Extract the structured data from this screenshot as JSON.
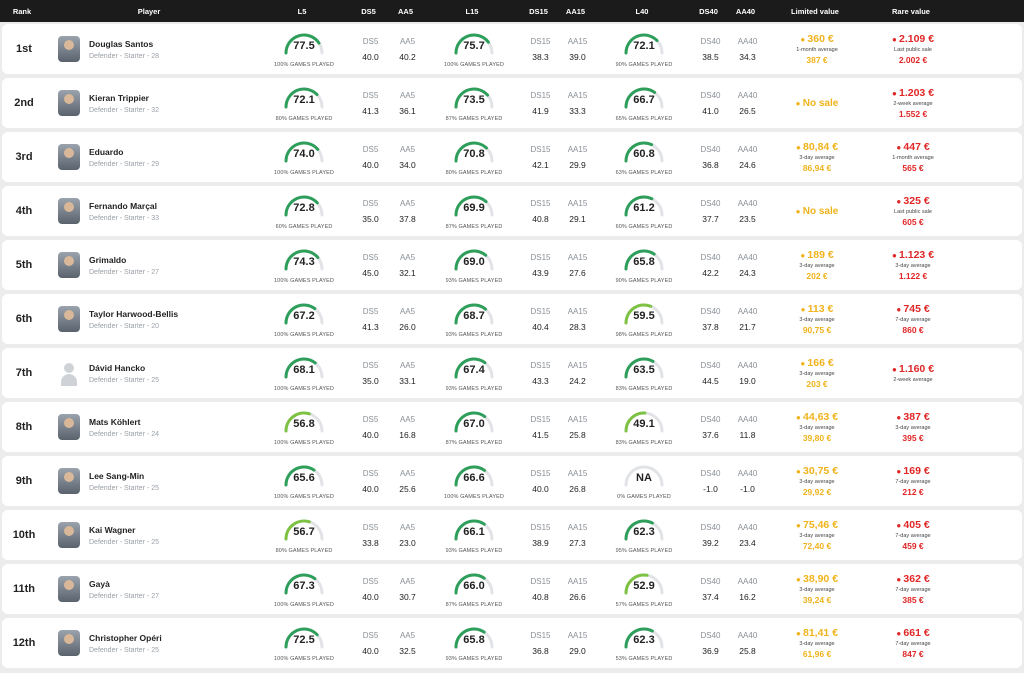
{
  "header": {
    "rank": "Rank",
    "player": "Player",
    "l5": "L5",
    "ds5": "DS5",
    "aa5": "AA5",
    "l15": "L15",
    "ds15": "DS15",
    "aa15": "AA15",
    "l40": "L40",
    "ds40": "DS40",
    "aa40": "AA40",
    "limited": "Limited value",
    "rare": "Rare value"
  },
  "labels": {
    "ds5": "DS5",
    "aa5": "AA5",
    "ds15": "DS15",
    "aa15": "AA15",
    "ds40": "DS40",
    "aa40": "AA40"
  },
  "colors": {
    "limited": "#f0b31c",
    "rare": "#e02626",
    "gauge_green": "#2e9e5b",
    "gauge_light": "#7dc242",
    "track": "#e1e3e6"
  },
  "rows": [
    {
      "rank": "1st",
      "name": "Douglas Santos",
      "desc": "Defender - Starter - 28",
      "l5": {
        "v": "77.5",
        "p": "100% GAMES PLAYED",
        "f": 0.775
      },
      "ds5": "40.0",
      "aa5": "40.2",
      "l15": {
        "v": "75.7",
        "p": "100% GAMES PLAYED",
        "f": 0.757
      },
      "ds15": "38.3",
      "aa15": "39.0",
      "l40": {
        "v": "72.1",
        "p": "90% GAMES PLAYED",
        "f": 0.721
      },
      "ds40": "38.5",
      "aa40": "34.3",
      "lim": {
        "main": "360 €",
        "label": "1-month average",
        "sub": "387 €"
      },
      "rare": {
        "main": "2.109 €",
        "label": "Last public sale",
        "sub": "2.002 €"
      }
    },
    {
      "rank": "2nd",
      "name": "Kieran Trippier",
      "desc": "Defender - Starter - 32",
      "l5": {
        "v": "72.1",
        "p": "80% GAMES PLAYED",
        "f": 0.721
      },
      "ds5": "41.3",
      "aa5": "36.1",
      "l15": {
        "v": "73.5",
        "p": "87% GAMES PLAYED",
        "f": 0.735
      },
      "ds15": "41.9",
      "aa15": "33.3",
      "l40": {
        "v": "66.7",
        "p": "65% GAMES PLAYED",
        "f": 0.667
      },
      "ds40": "41.0",
      "aa40": "26.5",
      "lim": {
        "main": "No sale",
        "label": "",
        "sub": ""
      },
      "rare": {
        "main": "1.203 €",
        "label": "2-week average",
        "sub": "1.552 €"
      }
    },
    {
      "rank": "3rd",
      "name": "Eduardo",
      "desc": "Defender - Starter - 29",
      "l5": {
        "v": "74.0",
        "p": "100% GAMES PLAYED",
        "f": 0.74
      },
      "ds5": "40.0",
      "aa5": "34.0",
      "l15": {
        "v": "70.8",
        "p": "80% GAMES PLAYED",
        "f": 0.708
      },
      "ds15": "42.1",
      "aa15": "29.9",
      "l40": {
        "v": "60.8",
        "p": "63% GAMES PLAYED",
        "f": 0.608
      },
      "ds40": "36.8",
      "aa40": "24.6",
      "lim": {
        "main": "80,84 €",
        "label": "3-day average",
        "sub": "86,94 €"
      },
      "rare": {
        "main": "447 €",
        "label": "1-month average",
        "sub": "565 €"
      }
    },
    {
      "rank": "4th",
      "name": "Fernando Marçal",
      "desc": "Defender - Starter - 33",
      "l5": {
        "v": "72.8",
        "p": "60% GAMES PLAYED",
        "f": 0.728
      },
      "ds5": "35.0",
      "aa5": "37.8",
      "l15": {
        "v": "69.9",
        "p": "87% GAMES PLAYED",
        "f": 0.699
      },
      "ds15": "40.8",
      "aa15": "29.1",
      "l40": {
        "v": "61.2",
        "p": "60% GAMES PLAYED",
        "f": 0.612
      },
      "ds40": "37.7",
      "aa40": "23.5",
      "lim": {
        "main": "No sale",
        "label": "",
        "sub": ""
      },
      "rare": {
        "main": "325 €",
        "label": "Last public sale",
        "sub": "605 €"
      }
    },
    {
      "rank": "5th",
      "name": "Grimaldo",
      "desc": "Defender - Starter - 27",
      "l5": {
        "v": "74.3",
        "p": "100% GAMES PLAYED",
        "f": 0.743
      },
      "ds5": "45.0",
      "aa5": "32.1",
      "l15": {
        "v": "69.0",
        "p": "93% GAMES PLAYED",
        "f": 0.69
      },
      "ds15": "43.9",
      "aa15": "27.6",
      "l40": {
        "v": "65.8",
        "p": "90% GAMES PLAYED",
        "f": 0.658
      },
      "ds40": "42.2",
      "aa40": "24.3",
      "lim": {
        "main": "189 €",
        "label": "3-day average",
        "sub": "202 €"
      },
      "rare": {
        "main": "1.123 €",
        "label": "3-day average",
        "sub": "1.122 €"
      }
    },
    {
      "rank": "6th",
      "name": "Taylor Harwood-Bellis",
      "desc": "Defender - Starter - 20",
      "l5": {
        "v": "67.2",
        "p": "100% GAMES PLAYED",
        "f": 0.672
      },
      "ds5": "41.3",
      "aa5": "26.0",
      "l15": {
        "v": "68.7",
        "p": "93% GAMES PLAYED",
        "f": 0.687
      },
      "ds15": "40.4",
      "aa15": "28.3",
      "l40": {
        "v": "59.5",
        "p": "98% GAMES PLAYED",
        "f": 0.595
      },
      "ds40": "37.8",
      "aa40": "21.7",
      "lim": {
        "main": "113 €",
        "label": "3-day average",
        "sub": "90,75 €"
      },
      "rare": {
        "main": "745 €",
        "label": "7-day average",
        "sub": "860 €"
      }
    },
    {
      "rank": "7th",
      "name": "Dávid Hancko",
      "desc": "Defender - Starter - 25",
      "l5": {
        "v": "68.1",
        "p": "100% GAMES PLAYED",
        "f": 0.681
      },
      "ds5": "35.0",
      "aa5": "33.1",
      "l15": {
        "v": "67.4",
        "p": "93% GAMES PLAYED",
        "f": 0.674
      },
      "ds15": "43.3",
      "aa15": "24.2",
      "l40": {
        "v": "63.5",
        "p": "83% GAMES PLAYED",
        "f": 0.635
      },
      "ds40": "44.5",
      "aa40": "19.0",
      "lim": {
        "main": "166 €",
        "label": "3-day average",
        "sub": "203 €"
      },
      "rare": {
        "main": "1.160 €",
        "label": "2-week average",
        "sub": ""
      }
    },
    {
      "rank": "8th",
      "name": "Mats Köhlert",
      "desc": "Defender - Starter - 24",
      "l5": {
        "v": "56.8",
        "p": "100% GAMES PLAYED",
        "f": 0.568
      },
      "ds5": "40.0",
      "aa5": "16.8",
      "l15": {
        "v": "67.0",
        "p": "87% GAMES PLAYED",
        "f": 0.67
      },
      "ds15": "41.5",
      "aa15": "25.8",
      "l40": {
        "v": "49.1",
        "p": "83% GAMES PLAYED",
        "f": 0.491
      },
      "ds40": "37.6",
      "aa40": "11.8",
      "lim": {
        "main": "44,63 €",
        "label": "3-day average",
        "sub": "39,80 €"
      },
      "rare": {
        "main": "387 €",
        "label": "3-day average",
        "sub": "395 €"
      }
    },
    {
      "rank": "9th",
      "name": "Lee Sang-Min",
      "desc": "Defender - Starter - 25",
      "l5": {
        "v": "65.6",
        "p": "100% GAMES PLAYED",
        "f": 0.656
      },
      "ds5": "40.0",
      "aa5": "25.6",
      "l15": {
        "v": "66.6",
        "p": "100% GAMES PLAYED",
        "f": 0.666
      },
      "ds15": "40.0",
      "aa15": "26.8",
      "l40": {
        "v": "NA",
        "p": "0% GAMES PLAYED",
        "f": 0
      },
      "ds40": "-1.0",
      "aa40": "-1.0",
      "lim": {
        "main": "30,75 €",
        "label": "3-day average",
        "sub": "29,92 €"
      },
      "rare": {
        "main": "169 €",
        "label": "7-day average",
        "sub": "212 €"
      }
    },
    {
      "rank": "10th",
      "name": "Kai Wagner",
      "desc": "Defender - Starter - 25",
      "l5": {
        "v": "56.7",
        "p": "80% GAMES PLAYED",
        "f": 0.567
      },
      "ds5": "33.8",
      "aa5": "23.0",
      "l15": {
        "v": "66.1",
        "p": "93% GAMES PLAYED",
        "f": 0.661
      },
      "ds15": "38.9",
      "aa15": "27.3",
      "l40": {
        "v": "62.3",
        "p": "95% GAMES PLAYED",
        "f": 0.623
      },
      "ds40": "39.2",
      "aa40": "23.4",
      "lim": {
        "main": "75,46 €",
        "label": "3-day average",
        "sub": "72,40 €"
      },
      "rare": {
        "main": "405 €",
        "label": "7-day average",
        "sub": "459 €"
      }
    },
    {
      "rank": "11th",
      "name": "Gayà",
      "desc": "Defender - Starter - 27",
      "l5": {
        "v": "67.3",
        "p": "100% GAMES PLAYED",
        "f": 0.673
      },
      "ds5": "40.0",
      "aa5": "30.7",
      "l15": {
        "v": "66.0",
        "p": "87% GAMES PLAYED",
        "f": 0.66
      },
      "ds15": "40.8",
      "aa15": "26.6",
      "l40": {
        "v": "52.9",
        "p": "57% GAMES PLAYED",
        "f": 0.529
      },
      "ds40": "37.4",
      "aa40": "16.2",
      "lim": {
        "main": "38,90 €",
        "label": "3-day average",
        "sub": "39,24 €"
      },
      "rare": {
        "main": "362 €",
        "label": "7-day average",
        "sub": "385 €"
      }
    },
    {
      "rank": "12th",
      "name": "Christopher Opéri",
      "desc": "Defender - Starter - 25",
      "l5": {
        "v": "72.5",
        "p": "100% GAMES PLAYED",
        "f": 0.725
      },
      "ds5": "40.0",
      "aa5": "32.5",
      "l15": {
        "v": "65.8",
        "p": "93% GAMES PLAYED",
        "f": 0.658
      },
      "ds15": "36.8",
      "aa15": "29.0",
      "l40": {
        "v": "62.3",
        "p": "53% GAMES PLAYED",
        "f": 0.623
      },
      "ds40": "36.9",
      "aa40": "25.8",
      "lim": {
        "main": "81,41 €",
        "label": "3-day average",
        "sub": "61,96 €"
      },
      "rare": {
        "main": "661 €",
        "label": "7-day average",
        "sub": "847 €"
      }
    }
  ]
}
